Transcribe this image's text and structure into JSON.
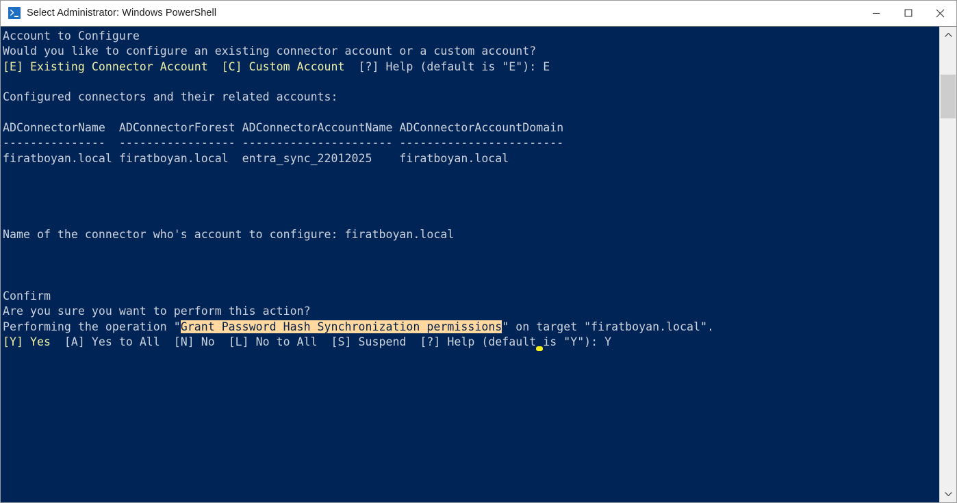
{
  "window": {
    "title": "Select Administrator: Windows PowerShell",
    "icon": "powershell-icon",
    "background_color": "#012456",
    "controls": {
      "minimize_label": "Minimize",
      "maximize_label": "Maximize",
      "close_label": "Close"
    }
  },
  "colors": {
    "console_background": "#012456",
    "default_text": "#ccd2dd",
    "choice_text": "#eeeda2",
    "highlight_background": "#ffd9a0",
    "highlight_text": "#05204a",
    "cursor": "#f6ef19"
  },
  "console": {
    "lines": [
      {
        "id": "l1",
        "segments": [
          {
            "text": "Account to Configure",
            "style": "white"
          }
        ]
      },
      {
        "id": "l2",
        "segments": [
          {
            "text": "Would you like to configure an existing connector account or a custom account?",
            "style": "white"
          }
        ]
      },
      {
        "id": "l3",
        "segments": [
          {
            "text": "[E] Existing Connector Account  [C] Custom Account  ",
            "style": "yellow"
          },
          {
            "text": "[?] Help (default is \"E\"): E",
            "style": "white"
          }
        ]
      },
      {
        "id": "l4",
        "segments": [
          {
            "text": "",
            "style": "white"
          }
        ]
      },
      {
        "id": "l5",
        "segments": [
          {
            "text": "Configured connectors and their related accounts:",
            "style": "white"
          }
        ]
      },
      {
        "id": "l6",
        "segments": [
          {
            "text": "",
            "style": "white"
          }
        ]
      },
      {
        "id": "l7",
        "segments": [
          {
            "text": "ADConnectorName  ADConnectorForest ADConnectorAccountName ADConnectorAccountDomain",
            "style": "white"
          }
        ]
      },
      {
        "id": "l8",
        "segments": [
          {
            "text": "---------------  ----------------- ---------------------- ------------------------",
            "style": "white"
          }
        ]
      },
      {
        "id": "l9",
        "segments": [
          {
            "text": "firatboyan.local firatboyan.local  entra_sync_22012025    firatboyan.local",
            "style": "white"
          }
        ]
      },
      {
        "id": "l10",
        "segments": [
          {
            "text": "",
            "style": "white"
          }
        ]
      },
      {
        "id": "l11",
        "segments": [
          {
            "text": "",
            "style": "white"
          }
        ]
      },
      {
        "id": "l12",
        "segments": [
          {
            "text": "",
            "style": "white"
          }
        ]
      },
      {
        "id": "l13",
        "segments": [
          {
            "text": "",
            "style": "white"
          }
        ]
      },
      {
        "id": "l14",
        "segments": [
          {
            "text": "Name of the connector who's account to configure: firatboyan.local",
            "style": "white"
          }
        ]
      },
      {
        "id": "l15",
        "segments": [
          {
            "text": "",
            "style": "white"
          }
        ]
      },
      {
        "id": "l16",
        "segments": [
          {
            "text": "",
            "style": "white"
          }
        ]
      },
      {
        "id": "l17",
        "segments": [
          {
            "text": "",
            "style": "white"
          }
        ]
      },
      {
        "id": "l18",
        "segments": [
          {
            "text": "Confirm",
            "style": "white"
          }
        ]
      },
      {
        "id": "l19",
        "segments": [
          {
            "text": "Are you sure you want to perform this action?",
            "style": "white"
          }
        ]
      },
      {
        "id": "l20",
        "segments": [
          {
            "text": "Performing the operation \"",
            "style": "white"
          },
          {
            "text": "Grant Password Hash Synchronization permissions",
            "style": "highlight"
          },
          {
            "text": "\" on target \"firatboyan.local\".",
            "style": "white"
          }
        ]
      },
      {
        "id": "l21",
        "segments": [
          {
            "text": "[Y] Yes  ",
            "style": "yellow"
          },
          {
            "text": "[A] Yes to All  [N] No  [L] No to All  [S] Suspend  [?] Help (default is \"Y\"): Y",
            "style": "white"
          }
        ]
      }
    ],
    "table": {
      "columns": [
        "ADConnectorName",
        "ADConnectorForest",
        "ADConnectorAccountName",
        "ADConnectorAccountDomain"
      ],
      "rows": [
        [
          "firatboyan.local",
          "firatboyan.local",
          "entra_sync_22012025",
          "firatboyan.local"
        ]
      ]
    },
    "prompts": [
      {
        "caption": "Account to Configure",
        "message": "Would you like to configure an existing connector account or a custom account?",
        "choices": [
          "[E] Existing Connector Account",
          "[C] Custom Account",
          "[?] Help"
        ],
        "default": "E",
        "answer": "E"
      },
      {
        "caption": "Confirm",
        "message": "Are you sure you want to perform this action?",
        "operation": "Grant Password Hash Synchronization permissions",
        "target": "firatboyan.local",
        "choices": [
          "[Y] Yes",
          "[A] Yes to All",
          "[N] No",
          "[L] No to All",
          "[S] Suspend",
          "[?] Help"
        ],
        "default": "Y",
        "answer": "Y"
      }
    ],
    "selected_text": "Grant Password Hash Synchronization permissions",
    "cursor": {
      "char_column": 78,
      "line_index": 20
    }
  },
  "scrollbar": {
    "up_arrow": "chevron-up-icon",
    "down_arrow": "chevron-down-icon",
    "thumb_label": "scrollbar-thumb"
  }
}
